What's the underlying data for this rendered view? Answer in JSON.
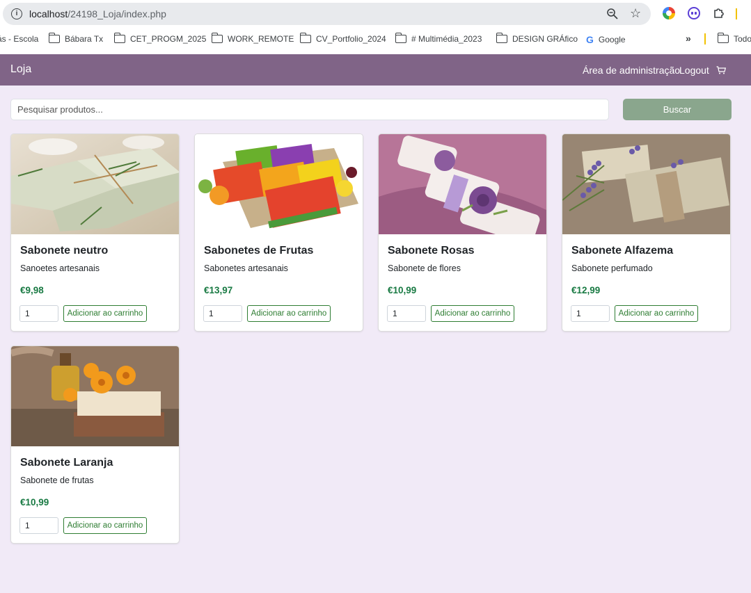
{
  "browser": {
    "url_host": "localhost",
    "url_path": "/24198_Loja/index.php",
    "bookmarks": [
      {
        "label": "ás - Escola",
        "folder": false
      },
      {
        "label": "Bábara Tx",
        "folder": true
      },
      {
        "label": "CET_PROGM_2025",
        "folder": true
      },
      {
        "label": "WORK_REMOTE",
        "folder": true
      },
      {
        "label": "CV_Portfolio_2024",
        "folder": true
      },
      {
        "label": "# Multimédia_2023",
        "folder": true
      },
      {
        "label": "DESIGN GRÁfico",
        "folder": true
      },
      {
        "label": "Google",
        "folder": false
      },
      {
        "label": "Todo",
        "folder": true
      }
    ],
    "more_label": "»"
  },
  "navbar": {
    "brand": "Loja",
    "admin_label": "Área de administração",
    "logout_label": "Logout",
    "color": "#806487"
  },
  "search": {
    "placeholder": "Pesquisar produtos...",
    "button_label": "Buscar"
  },
  "products": [
    {
      "name": "Sabonete neutro",
      "description": "Sanoetes artesanais",
      "price": "€9,98",
      "quantity": "1",
      "add_label": "Adicionar ao carrinho",
      "image": "neutral-soap-image"
    },
    {
      "name": "Sabonetes de Frutas",
      "description": "Sabonetes artesanais",
      "price": "€13,97",
      "quantity": "1",
      "add_label": "Adicionar ao carrinho",
      "image": "fruit-soap-image"
    },
    {
      "name": "Sabonete Rosas",
      "description": "Sabonete de flores",
      "price": "€10,99",
      "quantity": "1",
      "add_label": "Adicionar ao carrinho",
      "image": "rose-soap-image"
    },
    {
      "name": "Sabonete Alfazema",
      "description": "Sabonete perfumado",
      "price": "€12,99",
      "quantity": "1",
      "add_label": "Adicionar ao carrinho",
      "image": "lavender-soap-image"
    },
    {
      "name": "Sabonete Laranja",
      "description": "Sabonete de frutas",
      "price": "€10,99",
      "quantity": "1",
      "add_label": "Adicionar ao carrinho",
      "image": "orange-soap-image"
    }
  ],
  "colors": {
    "page_bg": "#f1eaf7",
    "price": "#197a43",
    "search_button": "#8aa68d",
    "add_button": "#2e7d32"
  }
}
